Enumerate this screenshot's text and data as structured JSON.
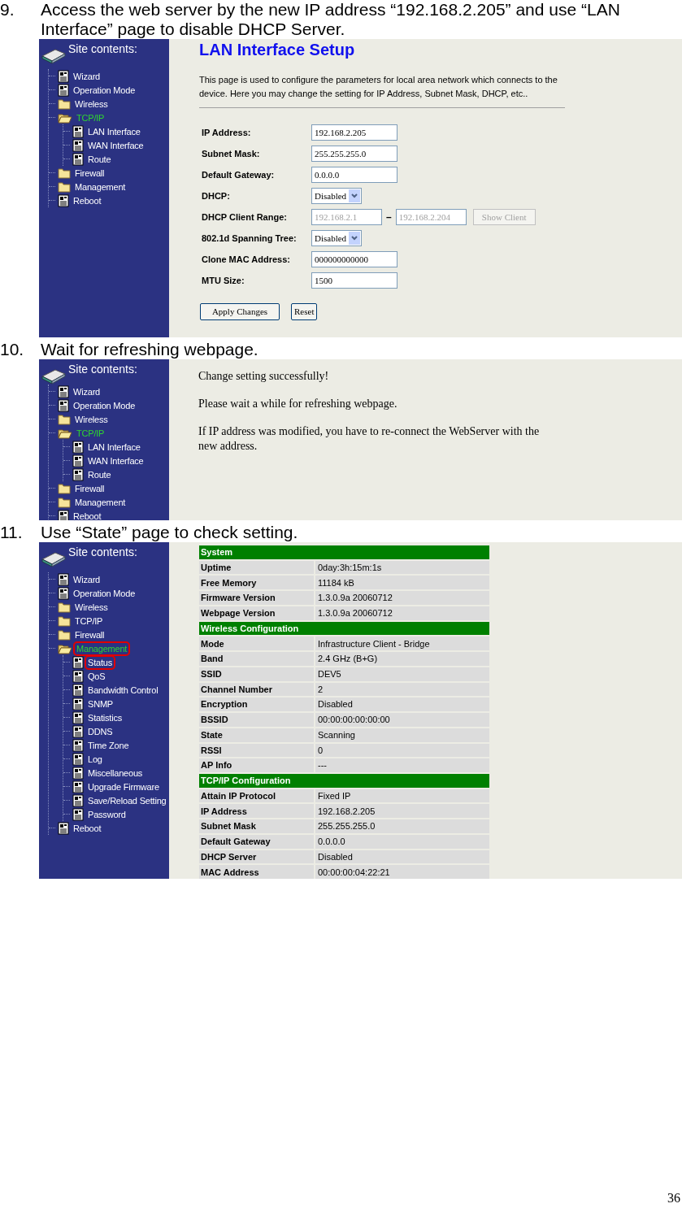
{
  "steps": [
    {
      "number": "9.",
      "text": "Access the web server by the new IP address “192.168.2.205” and use “LAN Interface” page to disable DHCP Server.",
      "screenshot": {
        "sidebar": {
          "title": "Site contents:",
          "items": [
            {
              "label": "Wizard",
              "kind": "page",
              "selected": false,
              "highlighted": false
            },
            {
              "label": "Operation Mode",
              "kind": "page",
              "selected": false,
              "highlighted": false
            },
            {
              "label": "Wireless",
              "kind": "folder",
              "expanded": false,
              "selected": false,
              "highlighted": false
            },
            {
              "label": "TCP/IP",
              "kind": "folder",
              "expanded": true,
              "selected": true,
              "highlighted": false,
              "children": [
                {
                  "label": "LAN Interface",
                  "kind": "page",
                  "selected": false,
                  "highlighted": false
                },
                {
                  "label": "WAN Interface",
                  "kind": "page",
                  "selected": false,
                  "highlighted": false
                },
                {
                  "label": "Route",
                  "kind": "page",
                  "selected": false,
                  "highlighted": false
                }
              ]
            },
            {
              "label": "Firewall",
              "kind": "folder",
              "expanded": false,
              "selected": false,
              "highlighted": false
            },
            {
              "label": "Management",
              "kind": "folder",
              "expanded": false,
              "selected": false,
              "highlighted": false
            },
            {
              "label": "Reboot",
              "kind": "page",
              "selected": false,
              "highlighted": false
            }
          ]
        },
        "content": {
          "kind": "form",
          "title": "LAN Interface Setup",
          "description": "This page is used to configure the parameters for local area network which connects to the device. Here you may change the setting for IP Address, Subnet Mask, DHCP, etc..",
          "fields": [
            {
              "label": "IP Address:",
              "kind": "text",
              "value": "192.168.2.205"
            },
            {
              "label": "Subnet Mask:",
              "kind": "text",
              "value": "255.255.255.0"
            },
            {
              "label": "Default Gateway:",
              "kind": "text",
              "value": "0.0.0.0"
            },
            {
              "label": "DHCP:",
              "kind": "select",
              "value": "Disabled"
            },
            {
              "label": "DHCP Client Range:",
              "kind": "range",
              "from": "192.168.2.1",
              "separator": "–",
              "to": "192.168.2.204",
              "button": "Show Client",
              "disabled": true
            },
            {
              "label": "802.1d Spanning Tree:",
              "kind": "select",
              "value": "Disabled"
            },
            {
              "label": "Clone MAC Address:",
              "kind": "text",
              "value": "000000000000"
            },
            {
              "label": "MTU Size:",
              "kind": "text",
              "value": "1500"
            }
          ],
          "buttons": [
            "Apply Changes",
            "Reset"
          ]
        }
      }
    },
    {
      "number": "10.",
      "text": "Wait for refreshing webpage.",
      "screenshot": {
        "sidebar": {
          "title": "Site contents:",
          "items": [
            {
              "label": "Wizard",
              "kind": "page",
              "selected": false,
              "highlighted": false
            },
            {
              "label": "Operation Mode",
              "kind": "page",
              "selected": false,
              "highlighted": false
            },
            {
              "label": "Wireless",
              "kind": "folder",
              "expanded": false,
              "selected": false,
              "highlighted": false
            },
            {
              "label": "TCP/IP",
              "kind": "folder",
              "expanded": true,
              "selected": true,
              "highlighted": false,
              "children": [
                {
                  "label": "LAN Interface",
                  "kind": "page",
                  "selected": false,
                  "highlighted": false
                },
                {
                  "label": "WAN Interface",
                  "kind": "page",
                  "selected": false,
                  "highlighted": false
                },
                {
                  "label": "Route",
                  "kind": "page",
                  "selected": false,
                  "highlighted": false
                }
              ]
            },
            {
              "label": "Firewall",
              "kind": "folder",
              "expanded": false,
              "selected": false,
              "highlighted": false
            },
            {
              "label": "Management",
              "kind": "folder",
              "expanded": false,
              "selected": false,
              "highlighted": false
            },
            {
              "label": "Reboot",
              "kind": "page",
              "selected": false,
              "highlighted": false
            }
          ]
        },
        "content": {
          "kind": "message",
          "paragraphs": [
            "Change setting successfully!",
            "Please wait a while for refreshing webpage.",
            "If IP address was modified, you have to re-connect the WebServer with the new address."
          ]
        }
      }
    },
    {
      "number": "11.",
      "text": "Use “State” page to check setting.",
      "screenshot": {
        "sidebar": {
          "title": "Site contents:",
          "items": [
            {
              "label": "Wizard",
              "kind": "page",
              "selected": false,
              "highlighted": false
            },
            {
              "label": "Operation Mode",
              "kind": "page",
              "selected": false,
              "highlighted": false
            },
            {
              "label": "Wireless",
              "kind": "folder",
              "expanded": false,
              "selected": false,
              "highlighted": false
            },
            {
              "label": "TCP/IP",
              "kind": "folder",
              "expanded": false,
              "selected": false,
              "highlighted": false
            },
            {
              "label": "Firewall",
              "kind": "folder",
              "expanded": false,
              "selected": false,
              "highlighted": false
            },
            {
              "label": "Management",
              "kind": "folder",
              "expanded": true,
              "selected": true,
              "highlighted": true,
              "children": [
                {
                  "label": "Status",
                  "kind": "page",
                  "selected": false,
                  "highlighted": true
                },
                {
                  "label": "QoS",
                  "kind": "page",
                  "selected": false,
                  "highlighted": false
                },
                {
                  "label": "Bandwidth Control",
                  "kind": "page",
                  "selected": false,
                  "highlighted": false
                },
                {
                  "label": "SNMP",
                  "kind": "page",
                  "selected": false,
                  "highlighted": false
                },
                {
                  "label": "Statistics",
                  "kind": "page",
                  "selected": false,
                  "highlighted": false
                },
                {
                  "label": "DDNS",
                  "kind": "page",
                  "selected": false,
                  "highlighted": false
                },
                {
                  "label": "Time Zone",
                  "kind": "page",
                  "selected": false,
                  "highlighted": false
                },
                {
                  "label": "Log",
                  "kind": "page",
                  "selected": false,
                  "highlighted": false
                },
                {
                  "label": "Miscellaneous",
                  "kind": "page",
                  "selected": false,
                  "highlighted": false
                },
                {
                  "label": "Upgrade Firmware",
                  "kind": "page",
                  "selected": false,
                  "highlighted": false
                },
                {
                  "label": "Save/Reload Setting",
                  "kind": "page",
                  "selected": false,
                  "highlighted": false
                },
                {
                  "label": "Password",
                  "kind": "page",
                  "selected": false,
                  "highlighted": false
                }
              ]
            },
            {
              "label": "Reboot",
              "kind": "page",
              "selected": false,
              "highlighted": false
            }
          ]
        },
        "content": {
          "kind": "status",
          "sections": [
            {
              "title": "System",
              "rows": [
                {
                  "label": "Uptime",
                  "value": "0day:3h:15m:1s"
                },
                {
                  "label": "Free Memory",
                  "value": "11184 kB"
                },
                {
                  "label": "Firmware Version",
                  "value": "1.3.0.9a 20060712"
                },
                {
                  "label": "Webpage Version",
                  "value": "1.3.0.9a 20060712"
                }
              ]
            },
            {
              "title": "Wireless Configuration",
              "rows": [
                {
                  "label": "Mode",
                  "value": "Infrastructure Client - Bridge"
                },
                {
                  "label": "Band",
                  "value": "2.4 GHz (B+G)"
                },
                {
                  "label": "SSID",
                  "value": "DEV5"
                },
                {
                  "label": "Channel Number",
                  "value": "2"
                },
                {
                  "label": "Encryption",
                  "value": "Disabled"
                },
                {
                  "label": "BSSID",
                  "value": "00:00:00:00:00:00"
                },
                {
                  "label": "State",
                  "value": "Scanning"
                },
                {
                  "label": "RSSI",
                  "value": "0"
                },
                {
                  "label": "AP Info",
                  "value": "---"
                }
              ]
            },
            {
              "title": "TCP/IP Configuration",
              "rows": [
                {
                  "label": "Attain IP Protocol",
                  "value": "Fixed IP"
                },
                {
                  "label": "IP Address",
                  "value": "192.168.2.205"
                },
                {
                  "label": "Subnet Mask",
                  "value": "255.255.255.0"
                },
                {
                  "label": "Default Gateway",
                  "value": "0.0.0.0"
                },
                {
                  "label": "DHCP Server",
                  "value": "Disabled"
                },
                {
                  "label": "MAC Address",
                  "value": "00:00:00:04:22:21"
                }
              ]
            }
          ]
        }
      }
    }
  ],
  "page_number": "36"
}
